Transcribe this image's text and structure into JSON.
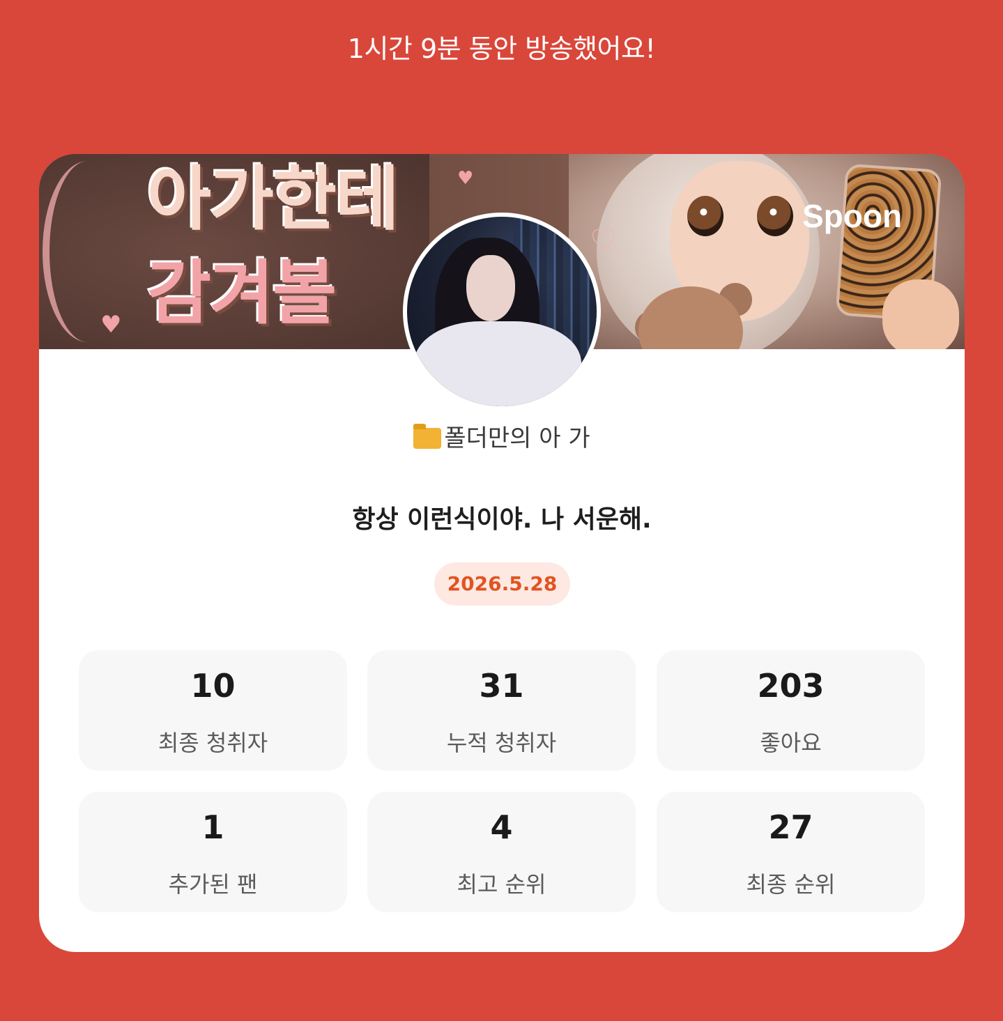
{
  "header": {
    "headline": "1시간 9분 동안 방송했어요!"
  },
  "banner": {
    "title_line1": "아가한테",
    "title_line2": "감겨볼",
    "brand": "Spoon"
  },
  "profile": {
    "nickname": "폴더만의 아 가",
    "nickname_icon": "folder-icon"
  },
  "broadcast": {
    "title": "항상 이런식이야. 나 서운해.",
    "date": "2026.5.28"
  },
  "stats": [
    {
      "value": "10",
      "label": "최종 청취자"
    },
    {
      "value": "31",
      "label": "누적 청취자"
    },
    {
      "value": "203",
      "label": "좋아요"
    },
    {
      "value": "1",
      "label": "추가된 팬"
    },
    {
      "value": "4",
      "label": "최고 순위"
    },
    {
      "value": "27",
      "label": "최종 순위"
    }
  ],
  "colors": {
    "background": "#d9473a",
    "card": "#ffffff",
    "date_text": "#e15421",
    "date_badge": "#fde9e2",
    "stat_box": "#f7f7f7"
  }
}
